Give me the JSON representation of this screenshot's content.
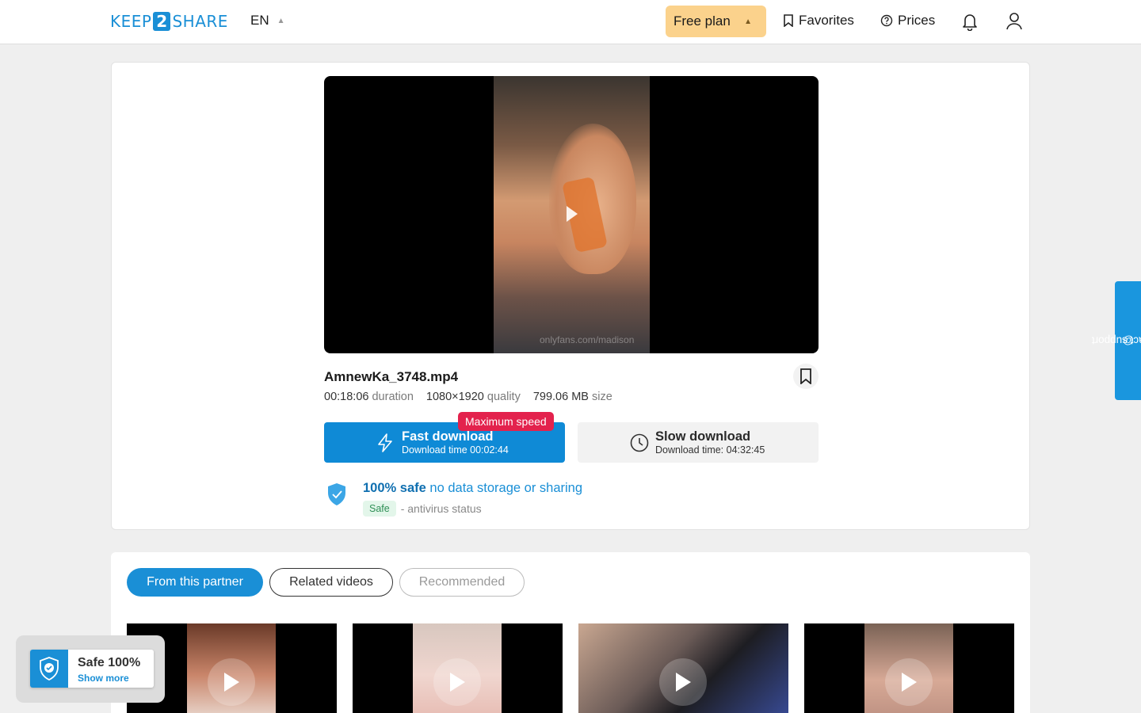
{
  "header": {
    "logo_left": "KEEP",
    "logo_mid": "2",
    "logo_right": "SHARE",
    "language": "EN",
    "plan": "Free plan",
    "favorites": "Favorites",
    "prices": "Prices"
  },
  "player": {
    "watermark": "onlyfans.com/madison"
  },
  "file": {
    "name": "AmnewKa_3748.mp4",
    "duration_value": "00:18:06",
    "duration_label": "duration",
    "quality_value": "1080×1920",
    "quality_label": "quality",
    "size_value": "799.06 MB",
    "size_label": "size"
  },
  "download": {
    "fast_title": "Fast download",
    "fast_time": "Download time 00:02:44",
    "max_speed": "Maximum speed",
    "slow_title": "Slow download",
    "slow_time": "Download time: 04:32:45"
  },
  "safety": {
    "strong": "100% safe",
    "rest": "no data storage or sharing",
    "badge": "Safe",
    "status": "- antivirus status"
  },
  "support": {
    "label": "contact support"
  },
  "tabs": [
    "From this partner",
    "Related videos",
    "Recommended"
  ],
  "safe_popup": {
    "title": "Safe 100%",
    "link": "Show more"
  },
  "colors": {
    "accent": "#1a8fd6",
    "plan": "#fbd28c",
    "max_speed": "#e3224d"
  },
  "icons": [
    "bookmark-icon",
    "help-circle-icon",
    "bell-icon",
    "user-icon",
    "bolt-icon",
    "clock-icon",
    "shield-check-icon",
    "play-icon",
    "at-icon",
    "chevron-up-icon"
  ]
}
